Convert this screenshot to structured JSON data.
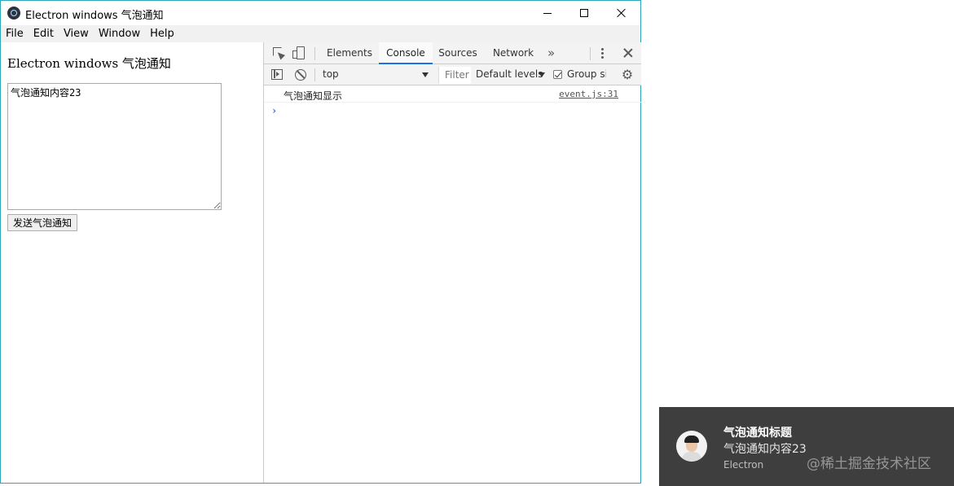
{
  "window": {
    "title": "Electron windows 气泡通知",
    "controls": {
      "minimize": "minimize",
      "maximize": "maximize",
      "close": "close"
    }
  },
  "menubar": {
    "items": [
      "File",
      "Edit",
      "View",
      "Window",
      "Help"
    ]
  },
  "page": {
    "heading": "Electron windows 气泡通知",
    "textarea_value": "气泡通知内容23",
    "send_button": "发送气泡通知"
  },
  "devtools": {
    "tabs": [
      "Elements",
      "Console",
      "Sources",
      "Network"
    ],
    "active_tab": "Console",
    "more_tabs": "»",
    "context": "top",
    "filter_placeholder": "Filter",
    "levels": "Default levels",
    "group_label": "Group similar",
    "group_checked": true,
    "console": {
      "log": {
        "message": "气泡通知显示",
        "source": "event.js:31"
      },
      "prompt": "›"
    },
    "accent_color": "#1a73e8"
  },
  "notification": {
    "title": "气泡通知标题",
    "body": "气泡通知内容23",
    "app": "Electron",
    "watermark": "@稀土掘金技术社区",
    "background": "#3e3e3e"
  }
}
